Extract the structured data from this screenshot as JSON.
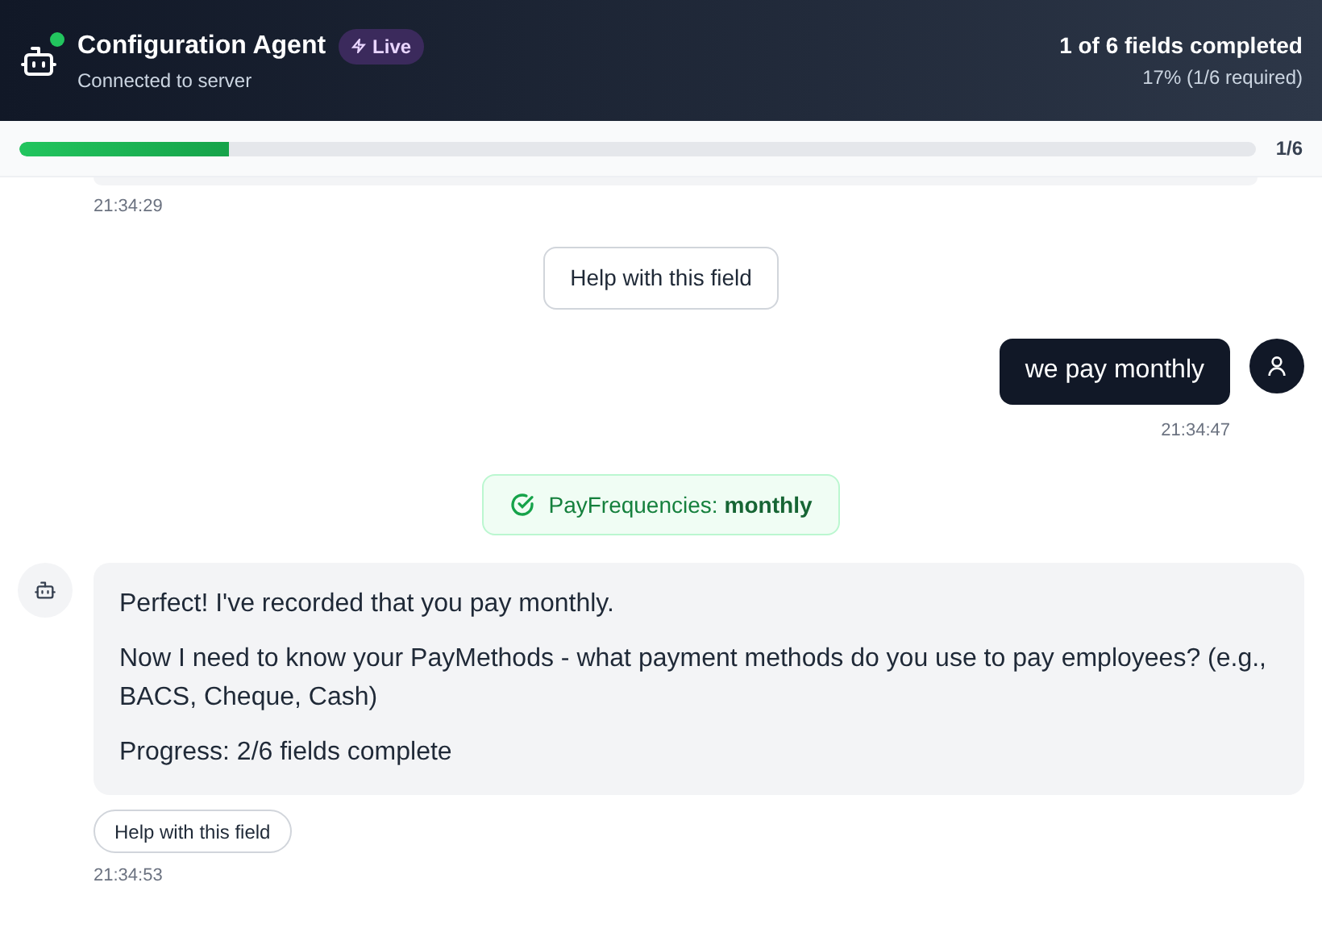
{
  "header": {
    "title": "Configuration Agent",
    "online": true,
    "badge": "Live",
    "subtitle": "Connected to server",
    "summary": "1 of 6 fields completed",
    "detail": "17% (1/6 required)"
  },
  "progress": {
    "level": 0.17,
    "label": "1/6"
  },
  "messages": [
    {
      "kind": "cut",
      "time": "21:34:29"
    },
    {
      "kind": "help",
      "label": "Help with this field"
    },
    {
      "kind": "user",
      "text": "we pay monthly",
      "time": "21:34:47"
    },
    {
      "kind": "recorded",
      "field": "PayFrequencies:",
      "value": "monthly"
    },
    {
      "kind": "agent",
      "paragraphs": [
        "Perfect! I've recorded that you pay monthly.",
        "Now I need to know your PayMethods - what payment methods do you use to pay employees? (e.g., BACS, Cheque, Cash)",
        "Progress: 2/6 fields complete"
      ],
      "help": "Help with this field",
      "time": "21:34:53"
    }
  ]
}
